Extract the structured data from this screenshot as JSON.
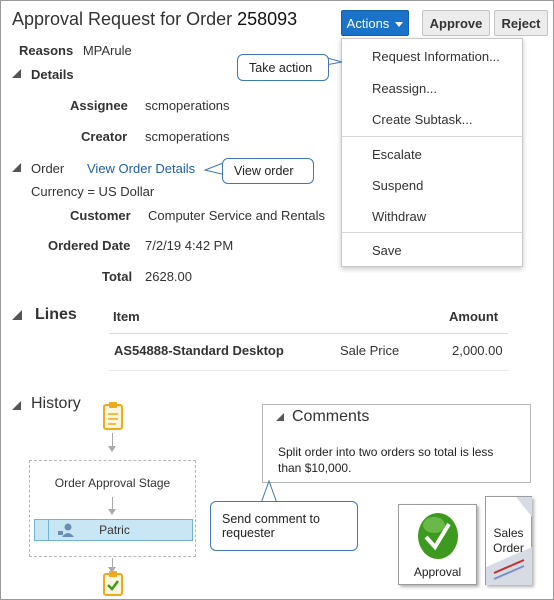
{
  "header": {
    "title_prefix": "Approval Request for Order",
    "order_number": "258093",
    "actions_label": "Actions",
    "approve_label": "Approve",
    "reject_label": "Reject"
  },
  "reasons": {
    "label": "Reasons",
    "value": "MPArule"
  },
  "details": {
    "heading": "Details",
    "assignee_label": "Assignee",
    "assignee_value": "scmoperations",
    "creator_label": "Creator",
    "creator_value": "scmoperations"
  },
  "order": {
    "label": "Order",
    "link": "View Order Details",
    "currency": "Currency = US Dollar",
    "customer_label": "Customer",
    "customer_value": "Computer Service and Rentals",
    "date_label": "Ordered Date",
    "date_value": "7/2/19 4:42 PM",
    "total_label": "Total",
    "total_value": "2628.00"
  },
  "actions_menu": {
    "items": [
      "Request Information...",
      "Reassign...",
      "Create Subtask...",
      "Escalate",
      "Suspend",
      "Withdraw",
      "Save"
    ]
  },
  "callouts": {
    "take_action": "Take action",
    "view_order": "View order",
    "send_comment_line1": "Send comment to",
    "send_comment_line2": "requester"
  },
  "lines": {
    "heading": "Lines",
    "col_item": "Item",
    "col_amount": "Amount",
    "row_item": "AS54888-Standard Desktop",
    "row_price_type": "Sale Price",
    "row_amount": "2,000.00"
  },
  "history": {
    "heading": "History",
    "stage_label": "Order Approval Stage",
    "participant": "Patric"
  },
  "comments": {
    "heading": "Comments",
    "text_line1": "Split order into two orders  so total is less",
    "text_line2": "than $10,000."
  },
  "badges": {
    "approval_label": "Approval",
    "sales_order_line1": "Sales",
    "sales_order_line2": "Order"
  },
  "colors": {
    "accent": "#1a73c8",
    "link": "#1f5fa9",
    "callout_border": "#3f78b4",
    "approval_green": "#3d9a1e",
    "participant_bg": "#c9e6f5"
  }
}
